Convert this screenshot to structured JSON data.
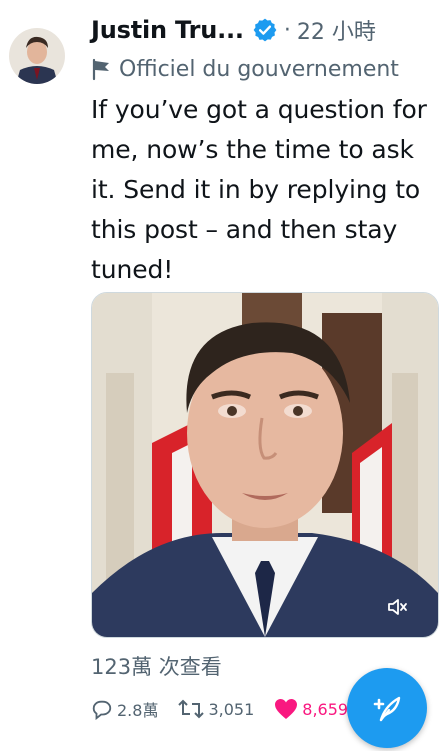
{
  "tweet": {
    "author_name": "Justin Tru...",
    "separator": "·",
    "time": "22 小時",
    "account_label": "Officiel du gouvernement",
    "text": "If you’ve got a question for me, now’s the time to ask it. Send it in by replying to this post – and then stay tuned!",
    "views": "123萬 次查看"
  },
  "actions": {
    "replies": "2.8萬",
    "retweets": "3,051",
    "likes": "8,659"
  },
  "icons": {
    "verified": "verified-badge-icon",
    "account_label": "flag-icon",
    "mute": "volume-muted-icon",
    "reply": "reply-icon",
    "retweet": "retweet-icon",
    "like": "heart-icon",
    "compose": "compose-icon"
  },
  "colors": {
    "accent": "#1d9bf0",
    "like": "#f91880",
    "secondary_text": "#536471"
  }
}
